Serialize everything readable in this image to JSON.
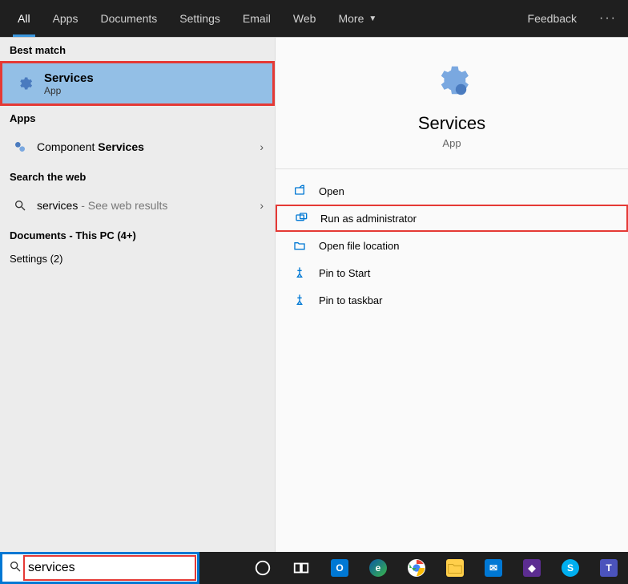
{
  "tabs": {
    "all": "All",
    "apps": "Apps",
    "documents": "Documents",
    "settings": "Settings",
    "email": "Email",
    "web": "Web",
    "more": "More",
    "feedback": "Feedback"
  },
  "left": {
    "best_match_label": "Best match",
    "best_match": {
      "title": "Services",
      "subtitle": "App"
    },
    "apps_label": "Apps",
    "component_services_pre": "Component ",
    "component_services_bold": "Services",
    "search_web_label": "Search the web",
    "web_query": "services",
    "web_suffix": " - See web results",
    "documents_label": "Documents - This PC (4+)",
    "settings_label": "Settings (2)"
  },
  "preview": {
    "title": "Services",
    "subtitle": "App",
    "actions": {
      "open": "Open",
      "run_admin": "Run as administrator",
      "open_loc": "Open file location",
      "pin_start": "Pin to Start",
      "pin_taskbar": "Pin to taskbar"
    }
  },
  "search": {
    "value": "services"
  }
}
